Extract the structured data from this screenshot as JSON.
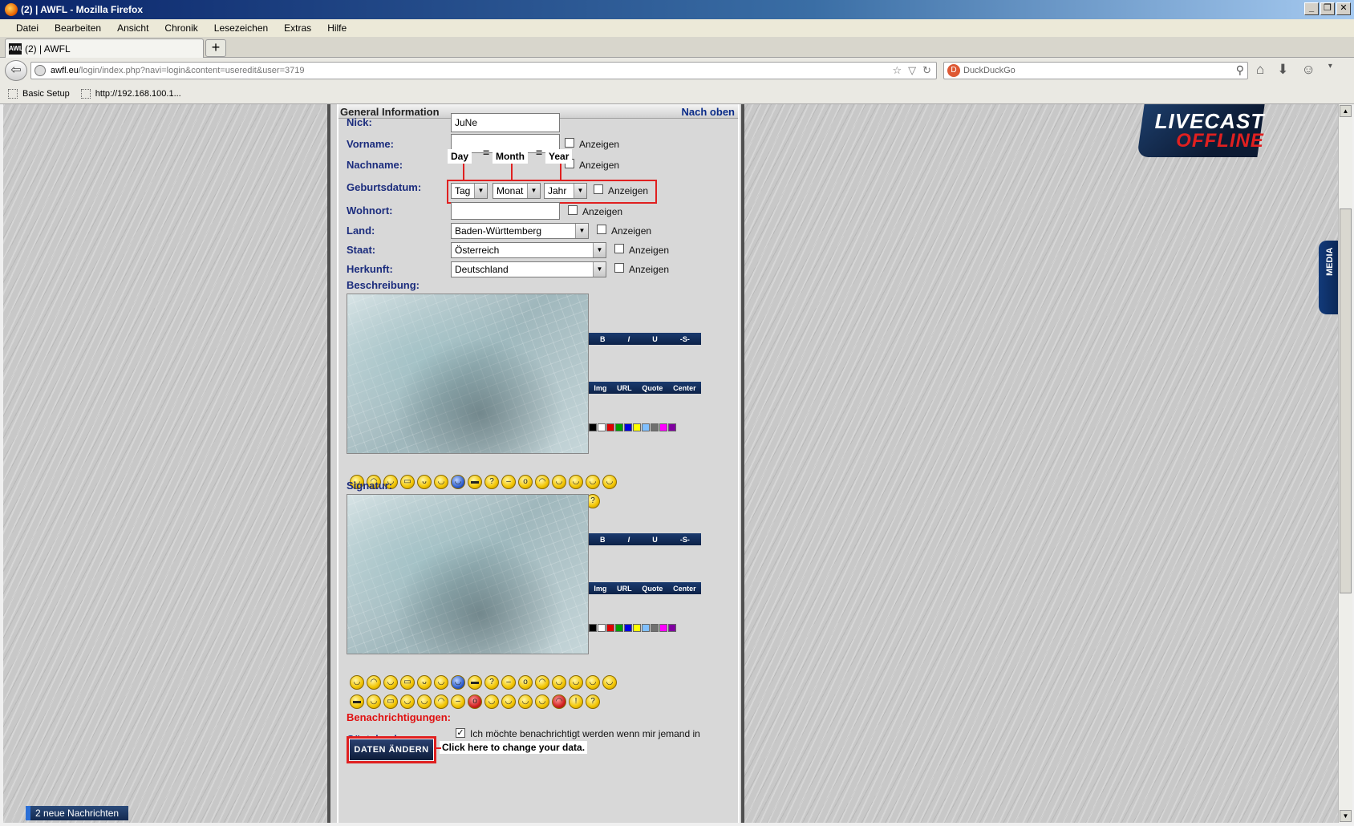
{
  "window": {
    "title": "(2) | AWFL - Mozilla Firefox",
    "buttons": [
      "_",
      "❐",
      "✕"
    ]
  },
  "menu": [
    "Datei",
    "Bearbeiten",
    "Ansicht",
    "Chronik",
    "Lesezeichen",
    "Extras",
    "Hilfe"
  ],
  "tab": {
    "title": "(2) | AWFL",
    "favicon": "AWL",
    "new_tab": "+"
  },
  "nav": {
    "url_host": "awfl.eu",
    "url_path": "/login/index.php?navi=login&content=useredit&user=3719",
    "search_placeholder": "DuckDuckGo"
  },
  "bookmarks": [
    "Basic Setup",
    "http://192.168.100.1..."
  ],
  "section": {
    "title": "General Information",
    "top_link": "Nach oben"
  },
  "fields": {
    "nick_label": "Nick:",
    "nick_value": "JuNe",
    "vorname_label": "Vorname:",
    "nachname_label": "Nachname:",
    "geburtsdatum_label": "Geburtsdatum:",
    "wohnort_label": "Wohnort:",
    "land_label": "Land:",
    "staat_label": "Staat:",
    "herkunft_label": "Herkunft:",
    "beschreibung_label": "Beschreibung:",
    "signatur_label": "Signatur:",
    "benachrichtigungen_label": "Benachrichtigungen:",
    "gaestebuch_label": "Gästebuch:",
    "show": "Anzeigen"
  },
  "selects": {
    "day": "Tag",
    "month": "Monat",
    "year": "Jahr",
    "land": "Baden-Württemberg",
    "staat": "Österreich",
    "herkunft": "Deutschland"
  },
  "annotations": {
    "day": "Day",
    "month": "Month",
    "year": "Year",
    "click_hint": "Click here to change your data."
  },
  "toolbar": {
    "row1": [
      "B",
      "I",
      "U",
      "-S-"
    ],
    "row2": [
      "Img",
      "URL",
      "Quote",
      "Center"
    ]
  },
  "colors": [
    "#000000",
    "#ffffff",
    "#e00000",
    "#00a000",
    "#0000e0",
    "#ffff00",
    "#80c0ff",
    "#707070",
    "#ff00ff",
    "#8000a0"
  ],
  "guestbook_notice": "Ich möchte benachrichtigt werden wenn mir jemand in mein Gästebuch schreibt",
  "submit_label": "DATEN ÄNDERN",
  "notification_bar": "2 neue Nachrichten",
  "livecast": {
    "line1": "LIVECAST",
    "line2": "OFFLINE"
  },
  "media_tab": "MEDIA"
}
